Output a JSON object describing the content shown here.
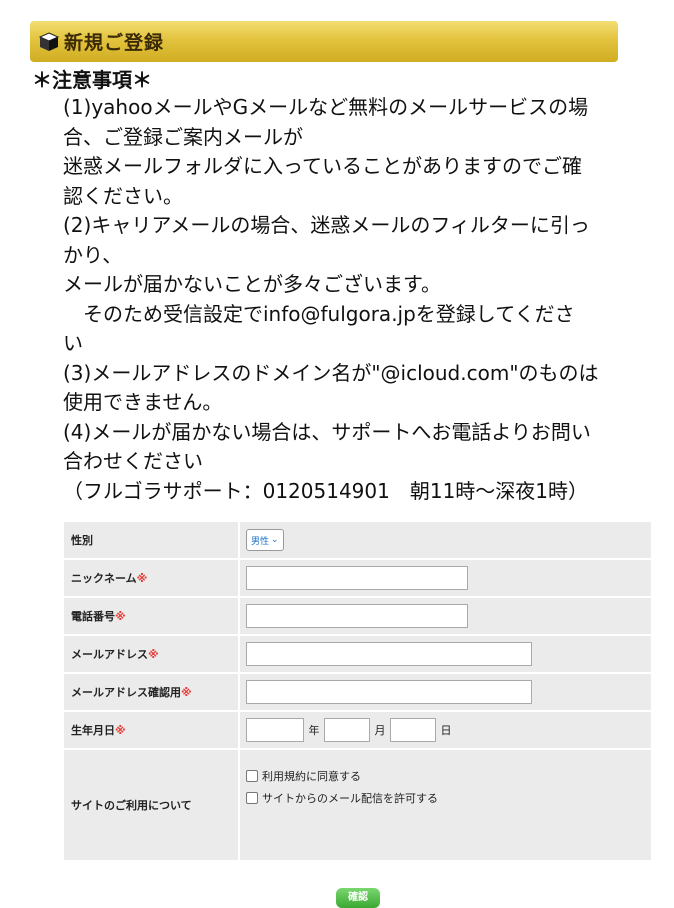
{
  "header": {
    "title": "新規ご登録",
    "icon": "box-icon"
  },
  "notice": {
    "title": "＊注意事項＊",
    "lines": [
      "(1)yahooメールやGメールなど無料のメールサービスの場",
      "合、ご登録ご案内メールが",
      "迷惑メールフォルダに入っていることがありますのでご確",
      "認ください。",
      "(2)キャリアメールの場合、迷惑メールのフィルターに引っ",
      "かり、",
      "メールが届かないことが多々ございます。",
      "　そのため受信設定でinfo@fulgora.jpを登録してくださ",
      "い",
      "(3)メールアドレスのドメイン名が\"@icloud.com\"のものは",
      "使用できません。",
      "(4)メールが届かない場合は、サポートへお電話よりお問い",
      "合わせください",
      "（フルゴラサポート：0120514901　朝11時〜深夜1時）"
    ]
  },
  "form": {
    "gender": {
      "label": "性別",
      "value": "男性"
    },
    "nickname": {
      "label": "ニックネーム",
      "required_mark": "※",
      "value": ""
    },
    "phone": {
      "label": "電話番号",
      "required_mark": "※",
      "value": ""
    },
    "email": {
      "label": "メールアドレス",
      "required_mark": "※",
      "value": ""
    },
    "email_confirm": {
      "label": "メールアドレス確認用",
      "required_mark": "※",
      "value": ""
    },
    "birthday": {
      "label": "生年月日",
      "required_mark": "※",
      "year_unit": "年",
      "month_unit": "月",
      "day_unit": "日"
    },
    "site_usage": {
      "label": "サイトのご利用について",
      "agree_terms": "利用規約に同意する",
      "allow_mail": "サイトからのメール配信を許可する"
    }
  },
  "submit_label": "確認"
}
